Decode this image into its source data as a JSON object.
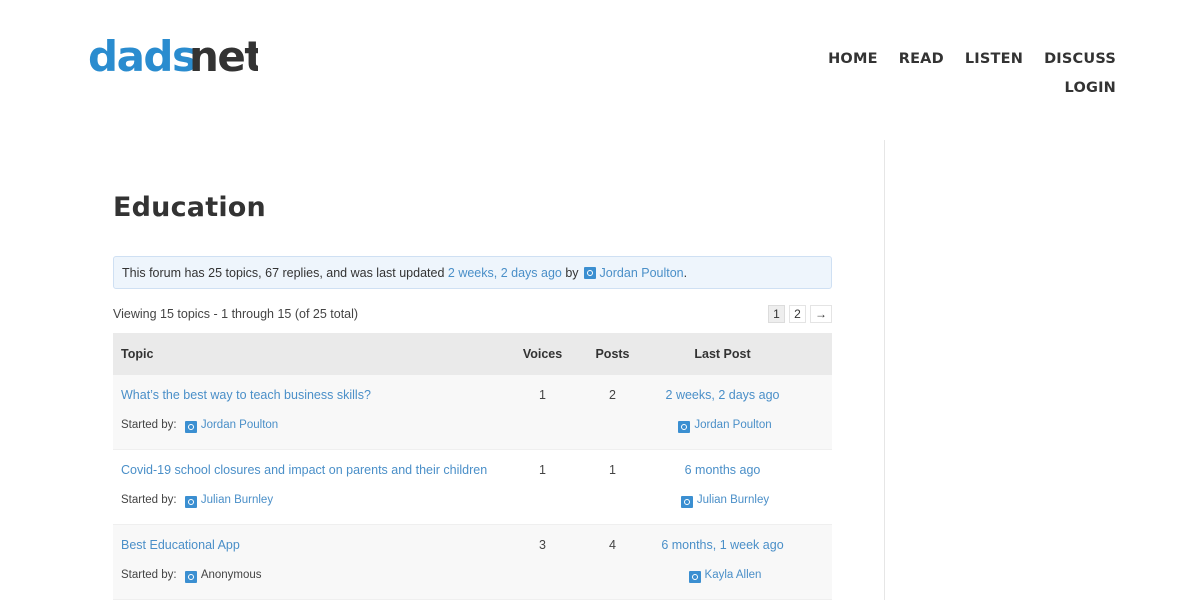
{
  "brand": {
    "logo_text": "dadsnet",
    "colors": {
      "dads": "#2a8ccf",
      "net": "#333333",
      "link": "#4a8fc8",
      "notice_bg": "#eef5fc"
    }
  },
  "nav": {
    "items": [
      "HOME",
      "READ",
      "LISTEN",
      "DISCUSS"
    ],
    "login": "LOGIN"
  },
  "page": {
    "title": "Education",
    "notice": {
      "prefix": "This forum has 25 topics, 67 replies, and was last updated",
      "updated": "2 weeks, 2 days ago",
      "by": "by",
      "user": "Jordan Poulton",
      "suffix": "."
    },
    "viewing": "Viewing 15 topics - 1 through 15 (of 25 total)",
    "pager": {
      "current": "1",
      "next_page": "2",
      "next_arrow": "→"
    }
  },
  "table": {
    "headers": {
      "topic": "Topic",
      "voices": "Voices",
      "posts": "Posts",
      "last": "Last Post"
    },
    "started_label": "Started by:",
    "rows": [
      {
        "title": "What’s the best way to teach business skills?",
        "author": "Jordan Poulton",
        "voices": "1",
        "posts": "2",
        "last_date": "2 weeks, 2 days ago",
        "last_user": "Jordan Poulton"
      },
      {
        "title": "Covid-19 school closures and impact on parents and their children",
        "author": "Julian Burnley",
        "voices": "1",
        "posts": "1",
        "last_date": "6 months ago",
        "last_user": "Julian Burnley"
      },
      {
        "title": "Best Educational App",
        "author": "Anonymous",
        "voices": "3",
        "posts": "4",
        "last_date": "6 months, 1 week ago",
        "last_user": "Kayla Allen"
      }
    ]
  }
}
